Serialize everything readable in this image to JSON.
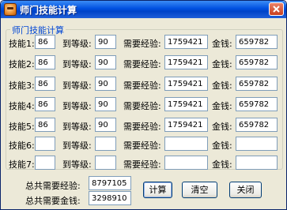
{
  "window": {
    "title": "师门技能计算"
  },
  "group": {
    "title": "师门技能计算"
  },
  "rows": [
    {
      "skill_label": "技能1:",
      "skill_value": "86",
      "level_label": "到等级:",
      "level_value": "90",
      "exp_label": "需要经验:",
      "exp_value": "1759421",
      "money_label": "金钱:",
      "money_value": "659782"
    },
    {
      "skill_label": "技能2:",
      "skill_value": "86",
      "level_label": "到等级:",
      "level_value": "90",
      "exp_label": "需要经验:",
      "exp_value": "1759421",
      "money_label": "金钱:",
      "money_value": "659782"
    },
    {
      "skill_label": "技能3:",
      "skill_value": "86",
      "level_label": "到等级:",
      "level_value": "90",
      "exp_label": "需要经验:",
      "exp_value": "1759421",
      "money_label": "金钱:",
      "money_value": "659782"
    },
    {
      "skill_label": "技能4:",
      "skill_value": "86",
      "level_label": "到等级:",
      "level_value": "90",
      "exp_label": "需要经验:",
      "exp_value": "1759421",
      "money_label": "金钱:",
      "money_value": "659782"
    },
    {
      "skill_label": "技能5:",
      "skill_value": "86",
      "level_label": "到等级:",
      "level_value": "90",
      "exp_label": "需要经验:",
      "exp_value": "1759421",
      "money_label": "金钱:",
      "money_value": "659782"
    },
    {
      "skill_label": "技能6:",
      "skill_value": "",
      "level_label": "到等级:",
      "level_value": "",
      "exp_label": "需要经验:",
      "exp_value": "",
      "money_label": "金钱:",
      "money_value": ""
    },
    {
      "skill_label": "技能7:",
      "skill_value": "",
      "level_label": "到等级:",
      "level_value": "",
      "exp_label": "需要经验:",
      "exp_value": "",
      "money_label": "金钱:",
      "money_value": ""
    }
  ],
  "totals": {
    "exp_label": "总共需要经验:",
    "exp_value": "8797105",
    "money_label": "总共需要金钱:",
    "money_value": "3298910"
  },
  "buttons": {
    "calc": "计算",
    "clear": "清空",
    "close": "关闭"
  },
  "icons": {
    "app": "character-face-icon",
    "close": "close-x-icon"
  }
}
